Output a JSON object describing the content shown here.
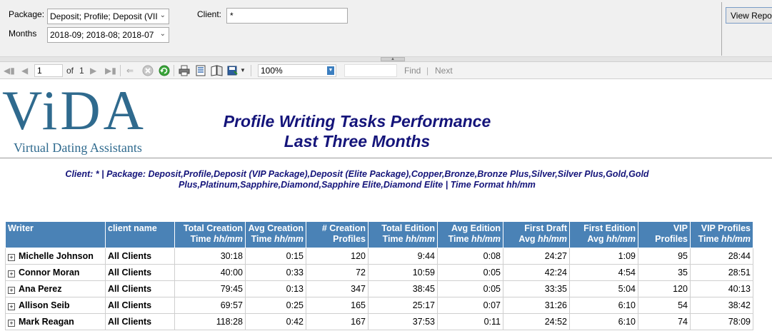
{
  "params": {
    "package_label": "Package:",
    "package_value": "Deposit; Profile; Deposit (VII",
    "months_label": "Months",
    "months_value": "2018-09; 2018-08; 2018-07",
    "client_label": "Client:",
    "client_value": "*",
    "view_report_label": "View Report"
  },
  "toolbar": {
    "page_current": "1",
    "page_of": "of",
    "page_total": "1",
    "zoom": "100%",
    "find_label": "Find",
    "find_sep": "|",
    "next_label": "Next"
  },
  "report": {
    "logo_word": "ViDA",
    "logo_tagline": "Virtual Dating Assistants",
    "title_line1": "Profile Writing Tasks Performance",
    "title_line2": "Last Three Months",
    "filter_line1": "Client: * | Package: Deposit,Profile,Deposit (VIP Package),Deposit (Elite Package),Copper,Bronze,Bronze Plus,Silver,Silver Plus,Gold,Gold",
    "filter_line2": "Plus,Platinum,Sapphire,Diamond,Sapphire Elite,Diamond Elite | Time Format hh/mm"
  },
  "table": {
    "headers": [
      {
        "line1": "Writer",
        "line2": "",
        "unit": ""
      },
      {
        "line1": "client name",
        "line2": "",
        "unit": ""
      },
      {
        "line1": "Total Creation",
        "line2": "Time ",
        "unit": "hh/mm"
      },
      {
        "line1": "Avg Creation",
        "line2": "Time ",
        "unit": "hh/mm"
      },
      {
        "line1": "# Creation",
        "line2": "Profiles",
        "unit": ""
      },
      {
        "line1": "Total Edition",
        "line2": "Time ",
        "unit": "hh/mm"
      },
      {
        "line1": "Avg Edition",
        "line2": "Time ",
        "unit": "hh/mm"
      },
      {
        "line1": "First Draft",
        "line2": "Avg ",
        "unit": "hh/mm"
      },
      {
        "line1": "First Edition",
        "line2": "Avg ",
        "unit": "hh/mm"
      },
      {
        "line1": "VIP",
        "line2": "Profiles",
        "unit": ""
      },
      {
        "line1": "VIP Profiles",
        "line2": "Time ",
        "unit": "hh/mm"
      }
    ],
    "rows": [
      [
        "Michelle Johnson",
        "All Clients",
        "30:18",
        "0:15",
        "120",
        "9:44",
        "0:08",
        "24:27",
        "1:09",
        "95",
        "28:44"
      ],
      [
        "Connor Moran",
        "All Clients",
        "40:00",
        "0:33",
        "72",
        "10:59",
        "0:05",
        "42:24",
        "4:54",
        "35",
        "28:51"
      ],
      [
        "Ana Perez",
        "All Clients",
        "79:45",
        "0:13",
        "347",
        "38:45",
        "0:05",
        "33:35",
        "5:04",
        "120",
        "40:13"
      ],
      [
        "Allison Seib",
        "All Clients",
        "69:57",
        "0:25",
        "165",
        "25:17",
        "0:07",
        "31:26",
        "6:10",
        "54",
        "38:42"
      ],
      [
        "Mark Reagan",
        "All Clients",
        "118:28",
        "0:42",
        "167",
        "37:53",
        "0:11",
        "24:52",
        "6:10",
        "74",
        "78:09"
      ]
    ]
  },
  "colors": {
    "header_bg": "#4a82b6",
    "title_text": "#14147a",
    "logo": "#2f6a8e"
  }
}
